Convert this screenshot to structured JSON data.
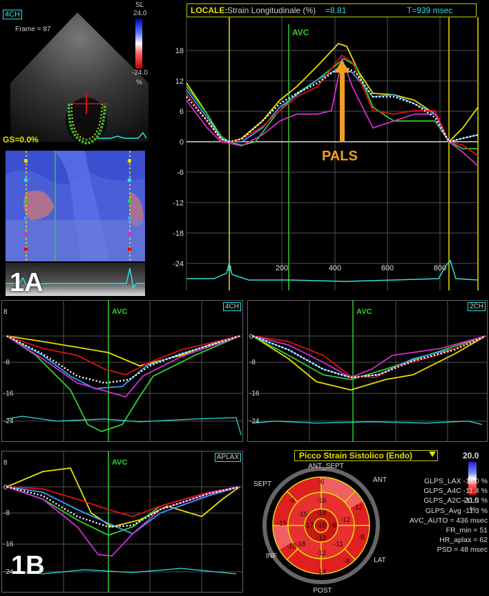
{
  "echo": {
    "view_tag": "4CH",
    "frame": "Frame = 87",
    "sl": "SL",
    "scale_top": "24.0",
    "scale_bottom": "-24.0",
    "scale_unit": "%",
    "gs": "GS=0.0%"
  },
  "panel_1a": "1A",
  "panel_1b": "1B",
  "locale": {
    "prefix": "LOCALE:",
    "title": "Strain Longitudinale (%)",
    "value": "=8.81",
    "time": "T=939 msec",
    "avc": "AVC",
    "annotation": "PALS",
    "yticks": [
      "18",
      "12",
      "6",
      "0",
      "-6",
      "-12",
      "-18",
      "-24"
    ],
    "xticks": [
      "0",
      "200",
      "400",
      "600",
      "800"
    ]
  },
  "small_4ch": {
    "tag": "4CH",
    "avc": "AVC",
    "yticks": [
      "8",
      "0",
      "-8",
      "-16",
      "-24"
    ]
  },
  "small_2ch": {
    "tag": "2CH",
    "avc": "AVC",
    "yticks": [
      "0",
      "-8",
      "-16",
      "-24"
    ]
  },
  "small_aplax": {
    "tag": "APLAX",
    "avc": "AVC",
    "yticks": [
      "8",
      "0",
      "-8",
      "-16",
      "-24"
    ]
  },
  "bullseye": {
    "title": "Picco Strain Sistolico (Endo)",
    "dropdown_icon": "triangle-down-icon",
    "labels": {
      "ant_sept": "ANT_SEPT",
      "ant": "ANT",
      "sept": "SEPT",
      "inf": "INF",
      "lat": "LAT",
      "post": "POST"
    },
    "outer": [
      "-6",
      "-12",
      "-8",
      "-8",
      "-14",
      "-15",
      "-15",
      "-4"
    ],
    "mid": [
      "-16",
      "-12",
      "-11",
      "-12",
      "-18",
      "-15"
    ],
    "inner": [
      "-14",
      "-8",
      "-13",
      "-17"
    ],
    "apex": "-15",
    "scale_top": "20.0",
    "scale_bottom": "-20.0",
    "scale_unit": "%"
  },
  "stats": [
    "GLPS_LAX  -11.0 %",
    "GLPS_A4C  -11.4 %",
    "GLPS_A2C  -11.5 %",
    "GLPS_Avg  -11.3 %",
    "AVC_AUTO = 436 msec",
    "FR_min = 51",
    "HR_aplax = 62",
    "PSD = 48 msec"
  ],
  "colors": {
    "yellow": "#e8e000",
    "green": "#30d030",
    "red": "#e01010",
    "blue": "#3aa0ff",
    "magenta": "#d030d0",
    "cyan": "#30e0e0",
    "white": "#ffffff",
    "frame": "#c8c800"
  }
}
